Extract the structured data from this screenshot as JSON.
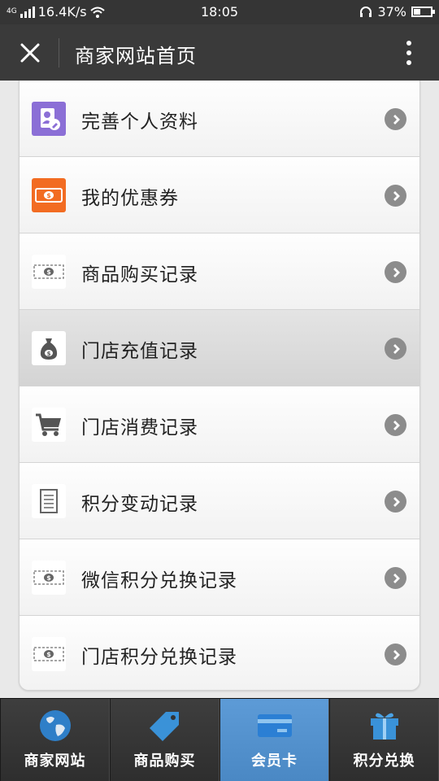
{
  "status_bar": {
    "network_type": "4G",
    "speed": "16.4K/s",
    "time": "18:05",
    "battery": "37%",
    "battery_level": 0.37
  },
  "header": {
    "title": "商家网站首页",
    "close_icon": "close-icon",
    "more_icon": "more-vertical-icon"
  },
  "menu": {
    "items": [
      {
        "label": "完善个人资料",
        "icon": "profile-edit-icon"
      },
      {
        "label": "我的优惠券",
        "icon": "coupon-icon"
      },
      {
        "label": "商品购买记录",
        "icon": "banknote-icon"
      },
      {
        "label": "门店充值记录",
        "icon": "money-bag-icon"
      },
      {
        "label": "门店消费记录",
        "icon": "shopping-cart-icon"
      },
      {
        "label": "积分变动记录",
        "icon": "document-icon"
      },
      {
        "label": "微信积分兑换记录",
        "icon": "banknote-icon"
      },
      {
        "label": "门店积分兑换记录",
        "icon": "banknote-icon"
      }
    ],
    "active_index": 3
  },
  "tab_bar": {
    "tabs": [
      {
        "label": "商家网站",
        "icon": "globe-icon"
      },
      {
        "label": "商品购买",
        "icon": "price-tag-icon"
      },
      {
        "label": "会员卡",
        "icon": "member-card-icon"
      },
      {
        "label": "积分兑换",
        "icon": "gift-icon"
      }
    ],
    "active_index": 2
  },
  "colors": {
    "title_bar": "#3a3a3a",
    "status_bar": "#353535",
    "active_tab": "#5591cd",
    "profile_icon": "#8b6fd6",
    "coupon_icon": "#f26c22",
    "arrow": "#8c8c8c"
  }
}
